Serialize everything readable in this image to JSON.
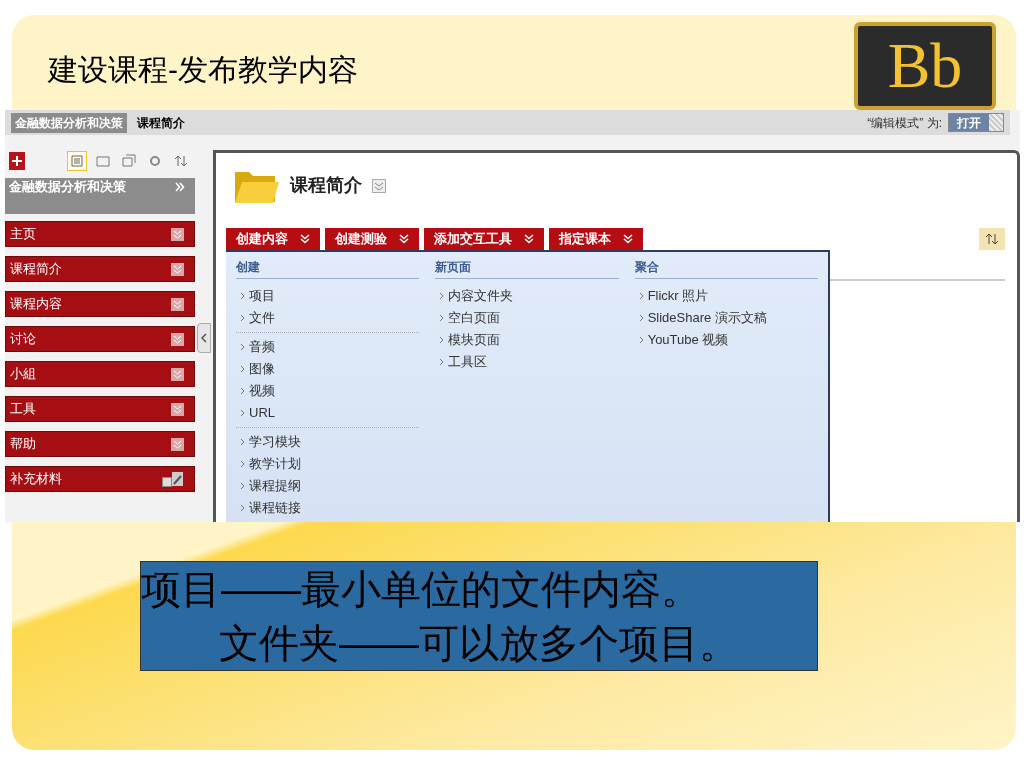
{
  "slide": {
    "title": "建设课程-发布教学内容",
    "logo": "Bb"
  },
  "breadcrumbs": [
    {
      "label": "金融数据分析和决策",
      "selected": false
    },
    {
      "label": "课程简介",
      "selected": true
    }
  ],
  "edit_mode": {
    "label": "“编辑模式” 为:",
    "toggle": "打开",
    "on": true
  },
  "sidebar": {
    "view_tools": [
      {
        "selected": true
      },
      {
        "selected": false
      },
      {
        "selected": false
      },
      {
        "selected": false
      },
      {
        "selected": false
      }
    ],
    "course": "金融数据分析和决策",
    "items": [
      {
        "label": "主页",
        "kind": "section"
      },
      {
        "label": "课程简介",
        "kind": "section"
      },
      {
        "label": "课程内容",
        "kind": "section"
      },
      {
        "label": "讨论",
        "kind": "section"
      },
      {
        "label": "小組",
        "kind": "section"
      },
      {
        "label": "工具",
        "kind": "section"
      },
      {
        "label": "帮助",
        "kind": "section"
      },
      {
        "label": "补充材料",
        "kind": "custom"
      }
    ]
  },
  "page": {
    "title": "课程简介",
    "actions": [
      {
        "label": "创建内容"
      },
      {
        "label": "创建测验"
      },
      {
        "label": "添加交互工具"
      },
      {
        "label": "指定课本"
      }
    ],
    "menu": [
      {
        "heading": "创建",
        "groups": [
          [
            "项目",
            "文件"
          ],
          [
            "音频",
            "图像",
            "视频",
            "URL"
          ],
          [
            "学习模块",
            "教学计划",
            "课程提纲",
            "课程链接"
          ]
        ]
      },
      {
        "heading": "新页面",
        "groups": [
          [
            "内容文件夹",
            "空白页面",
            "模块页面",
            "工具区"
          ]
        ]
      },
      {
        "heading": "聚合",
        "groups": [
          [
            "Flickr 照片",
            "SlideShare 演示文稿",
            "YouTube 视频"
          ]
        ]
      }
    ]
  },
  "caption": [
    "项目——最小单位的文件内容。",
    "文件夹——可以放多个项目。"
  ]
}
